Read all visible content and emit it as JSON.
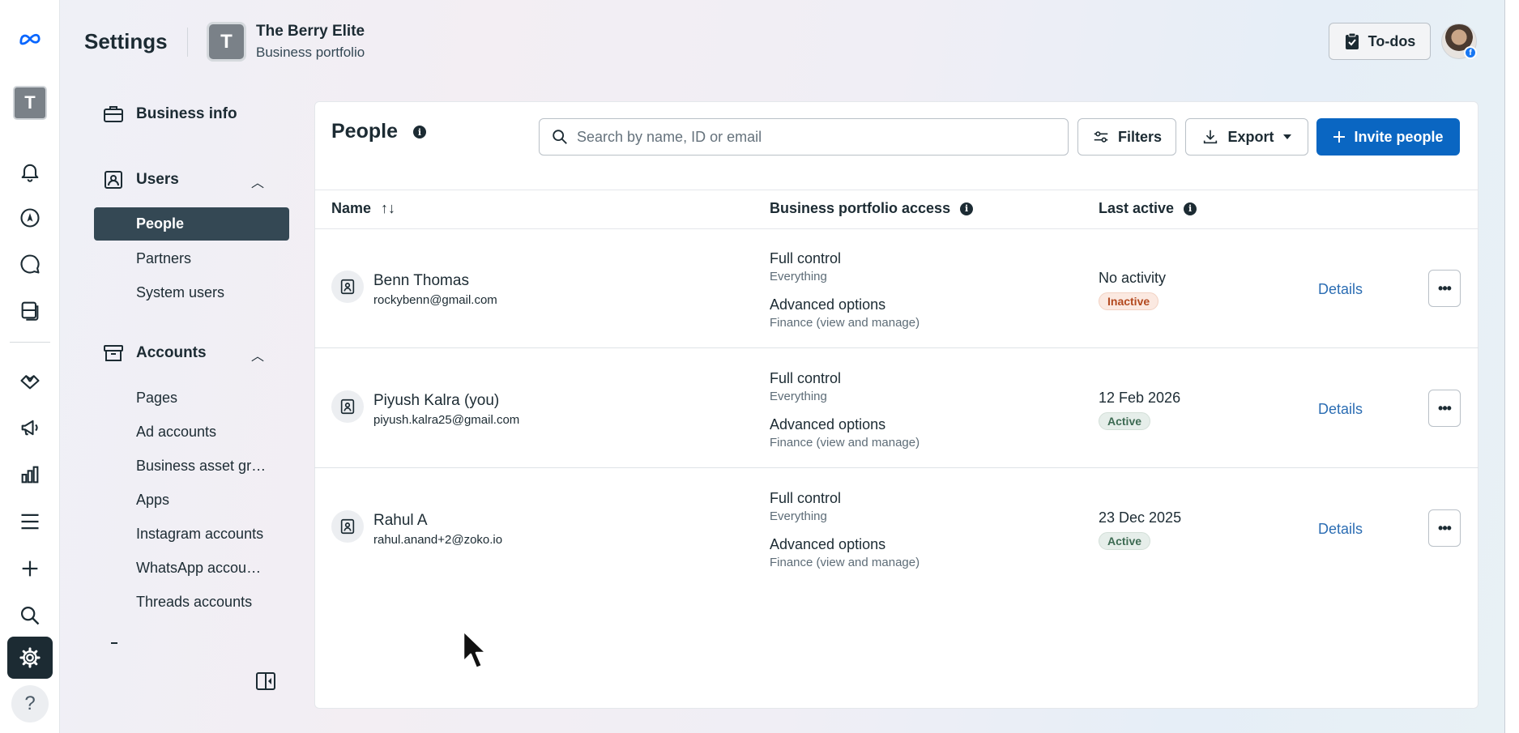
{
  "header": {
    "title": "Settings",
    "portfolio_initial": "T",
    "portfolio_name": "The Berry Elite",
    "portfolio_type": "Business portfolio",
    "todo_label": "To-dos"
  },
  "rail": {
    "portfolio_initial": "T",
    "help_label": "?",
    "icons": [
      "meta-logo-icon",
      "bell-icon",
      "compass-icon",
      "chat-icon",
      "pages-icon",
      "handshake-icon",
      "megaphone-icon",
      "bar-chart-icon",
      "menu-icon",
      "plus-icon",
      "search-icon",
      "gear-icon",
      "help-icon"
    ]
  },
  "nav": {
    "business_info": "Business info",
    "users_label": "Users",
    "users_items": [
      "People",
      "Partners",
      "System users"
    ],
    "accounts_label": "Accounts",
    "accounts_items": [
      "Pages",
      "Ad accounts",
      "Business asset gr…",
      "Apps",
      "Instagram accounts",
      "WhatsApp accou…",
      "Threads accounts"
    ]
  },
  "people": {
    "title": "People",
    "search_placeholder": "Search by name, ID or email",
    "filters_label": "Filters",
    "export_label": "Export",
    "invite_label": "Invite people",
    "columns": {
      "name": "Name",
      "sort_glyph": "↑↓",
      "access": "Business portfolio access",
      "last_active": "Last active"
    },
    "rows": [
      {
        "name": "Benn Thomas",
        "email": "rockybenn@gmail.com",
        "access_1": "Full control",
        "access_1_sub": "Everything",
        "access_2": "Advanced options",
        "access_2_sub": "Finance (view and manage)",
        "last_active": "No activity",
        "status": "Inactive",
        "details": "Details",
        "more": "•••"
      },
      {
        "name": "Piyush Kalra (you)",
        "email": "piyush.kalra25@gmail.com",
        "access_1": "Full control",
        "access_1_sub": "Everything",
        "access_2": "Advanced options",
        "access_2_sub": "Finance (view and manage)",
        "last_active": "12 Feb 2026",
        "status": "Active",
        "details": "Details",
        "more": "•••"
      },
      {
        "name": "Rahul A",
        "email": "rahul.anand+2@zoko.io",
        "access_1": "Full control",
        "access_1_sub": "Everything",
        "access_2": "Advanced options",
        "access_2_sub": "Finance (view and manage)",
        "last_active": "23 Dec 2025",
        "status": "Active",
        "details": "Details",
        "more": "•••"
      }
    ]
  },
  "colors": {
    "primary": "#0a66c2",
    "nav_active": "#344854",
    "link": "#2b6db3",
    "inactive_badge": "#b3491f",
    "active_badge": "#3d6b53"
  }
}
